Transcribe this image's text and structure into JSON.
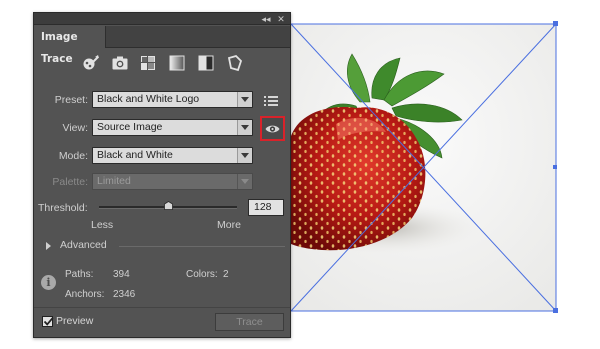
{
  "panel": {
    "tab_label": "Image Trace",
    "collapse_glyph": "◂◂",
    "close_glyph": "✕",
    "preset_icons": [
      "auto-color-icon",
      "high-color-photo-icon",
      "low-color-grid-icon",
      "grayscale-icon",
      "black-white-icon",
      "outline-icon"
    ]
  },
  "fields": {
    "preset_label": "Preset:",
    "preset_value": "Black and White Logo",
    "view_label": "View:",
    "view_value": "Source Image",
    "mode_label": "Mode:",
    "mode_value": "Black and White",
    "palette_label": "Palette:",
    "palette_value": "Limited"
  },
  "threshold": {
    "label": "Threshold:",
    "value": "128",
    "min_label": "Less",
    "max_label": "More",
    "level": 0.5
  },
  "advanced": {
    "label": "Advanced"
  },
  "stats": {
    "paths_label": "Paths:",
    "paths_value": "394",
    "colors_label": "Colors:",
    "colors_value": "2",
    "anchors_label": "Anchors:",
    "anchors_value": "2346"
  },
  "preview": {
    "label": "Preview",
    "checked": true
  },
  "trace_button": {
    "label": "Trace",
    "enabled": false
  },
  "colors": {
    "panel_bg": "#535353",
    "highlight": "#d9222a",
    "selection": "#4a6fe0"
  }
}
